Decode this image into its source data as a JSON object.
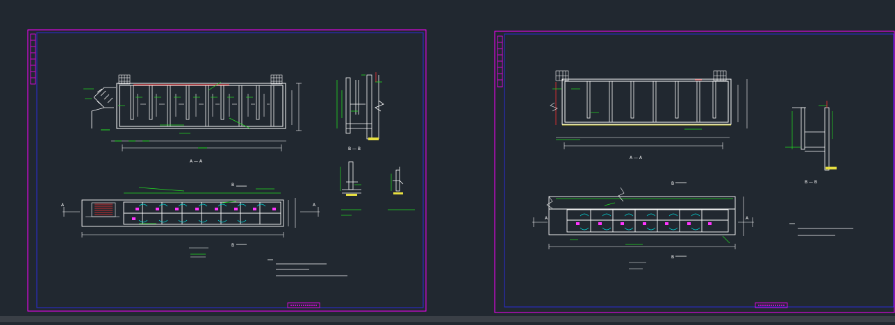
{
  "viewport": {
    "background": "#212830",
    "frame_outer_color": "#ff00ff",
    "frame_inner_color": "#2b2bd8",
    "line_white": "#ffffff",
    "line_green": "#22e022",
    "line_cyan": "#00e5e5",
    "line_red": "#ff3030",
    "line_yellow": "#e8e040"
  },
  "sheet_left": {
    "section_marks": {
      "aa": "A — A",
      "bb": "B — B",
      "a_left": "A",
      "a_right": "A",
      "b_top": "B",
      "b_bottom": "B"
    }
  },
  "sheet_right": {
    "section_marks": {
      "aa": "A — A",
      "bb": "B — B",
      "a_left": "A",
      "a_right": "A",
      "b_top": "B",
      "b_bottom": "B"
    }
  }
}
